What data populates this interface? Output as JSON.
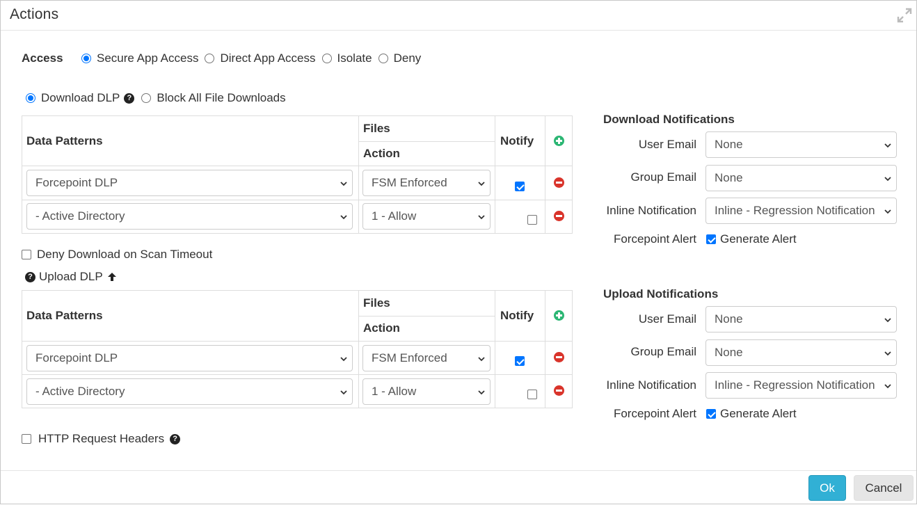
{
  "dialog": {
    "title": "Actions"
  },
  "access": {
    "label": "Access",
    "options": [
      "Secure App Access",
      "Direct App Access",
      "Isolate",
      "Deny"
    ],
    "selected": "Secure App Access"
  },
  "download_mode": {
    "options": [
      "Download DLP",
      "Block All File Downloads"
    ],
    "selected": "Download DLP"
  },
  "table_headers": {
    "data_patterns": "Data Patterns",
    "files": "Files",
    "action": "Action",
    "notify": "Notify"
  },
  "download_table": {
    "rows": [
      {
        "pattern": "Forcepoint DLP",
        "action": "FSM Enforced",
        "notify": true
      },
      {
        "pattern": "- Active Directory",
        "action": "1 - Allow",
        "notify": false
      }
    ]
  },
  "deny_download_timeout": {
    "label": "Deny Download on Scan Timeout",
    "checked": false
  },
  "upload_dlp": {
    "label": "Upload DLP"
  },
  "upload_table": {
    "rows": [
      {
        "pattern": "Forcepoint DLP",
        "action": "FSM Enforced",
        "notify": true
      },
      {
        "pattern": "- Active Directory",
        "action": "1 - Allow",
        "notify": false
      }
    ]
  },
  "http_headers": {
    "label": "HTTP Request Headers",
    "checked": false
  },
  "download_notifications": {
    "title": "Download Notifications",
    "user_email_label": "User Email",
    "user_email_value": "None",
    "group_email_label": "Group Email",
    "group_email_value": "None",
    "inline_label": "Inline Notification",
    "inline_value": "Inline - Regression Notification",
    "alert_label": "Forcepoint Alert",
    "alert_option": "Generate Alert",
    "alert_checked": true
  },
  "upload_notifications": {
    "title": "Upload Notifications",
    "user_email_label": "User Email",
    "user_email_value": "None",
    "group_email_label": "Group Email",
    "group_email_value": "None",
    "inline_label": "Inline Notification",
    "inline_value": "Inline - Regression Notification",
    "alert_label": "Forcepoint Alert",
    "alert_option": "Generate Alert",
    "alert_checked": true
  },
  "footer": {
    "ok_label": "Ok",
    "cancel_label": "Cancel"
  },
  "colors": {
    "primary_blue": "#0075ff",
    "ok_button": "#31b0d5",
    "add_green": "#2bb673",
    "remove_red": "#d9342b"
  }
}
